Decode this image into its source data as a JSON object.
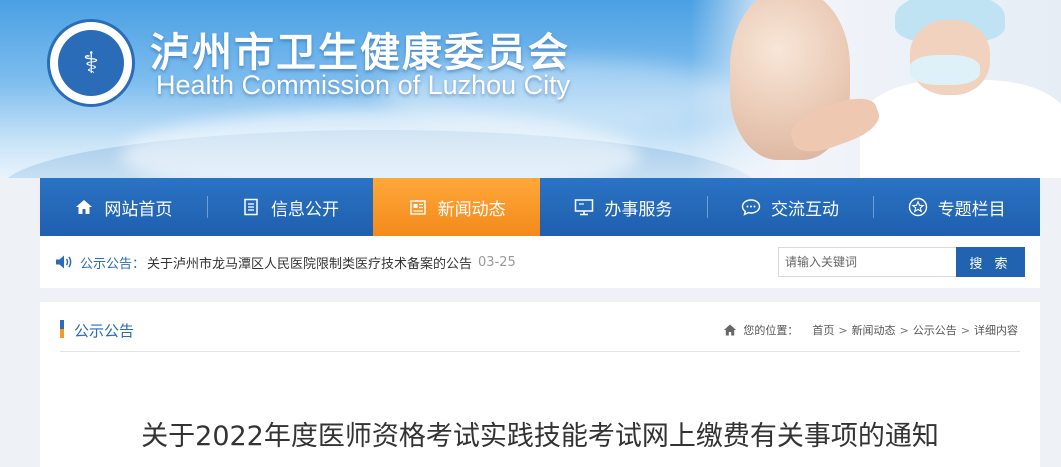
{
  "site": {
    "title_cn": "泸州市卫生健康委员会",
    "title_en": "Health Commission of Luzhou City"
  },
  "nav": {
    "items": [
      {
        "label": "网站首页",
        "icon": "home-icon"
      },
      {
        "label": "信息公开",
        "icon": "document-icon"
      },
      {
        "label": "新闻动态",
        "icon": "news-icon",
        "active": true
      },
      {
        "label": "办事服务",
        "icon": "monitor-icon"
      },
      {
        "label": "交流互动",
        "icon": "chat-icon"
      },
      {
        "label": "专题栏目",
        "icon": "star-icon"
      }
    ]
  },
  "notice": {
    "label": "公示公告：",
    "text": "关于泸州市龙马潭区人民医院限制类医疗技术备案的公告",
    "date": "03-25"
  },
  "search": {
    "placeholder": "请输入关键词",
    "button": "搜 索"
  },
  "content": {
    "category": "公示公告",
    "breadcrumb": {
      "location_label": "您的位置：",
      "items": [
        "首页",
        "新闻动态",
        "公示公告",
        "详细内容"
      ]
    },
    "article_title": "关于2022年度医师资格考试实践技能考试网上缴费有关事项的通知"
  },
  "colors": {
    "primary": "#2a6cb7",
    "nav_active": "#f28a1a",
    "accent_bar": "#f39a2b"
  }
}
